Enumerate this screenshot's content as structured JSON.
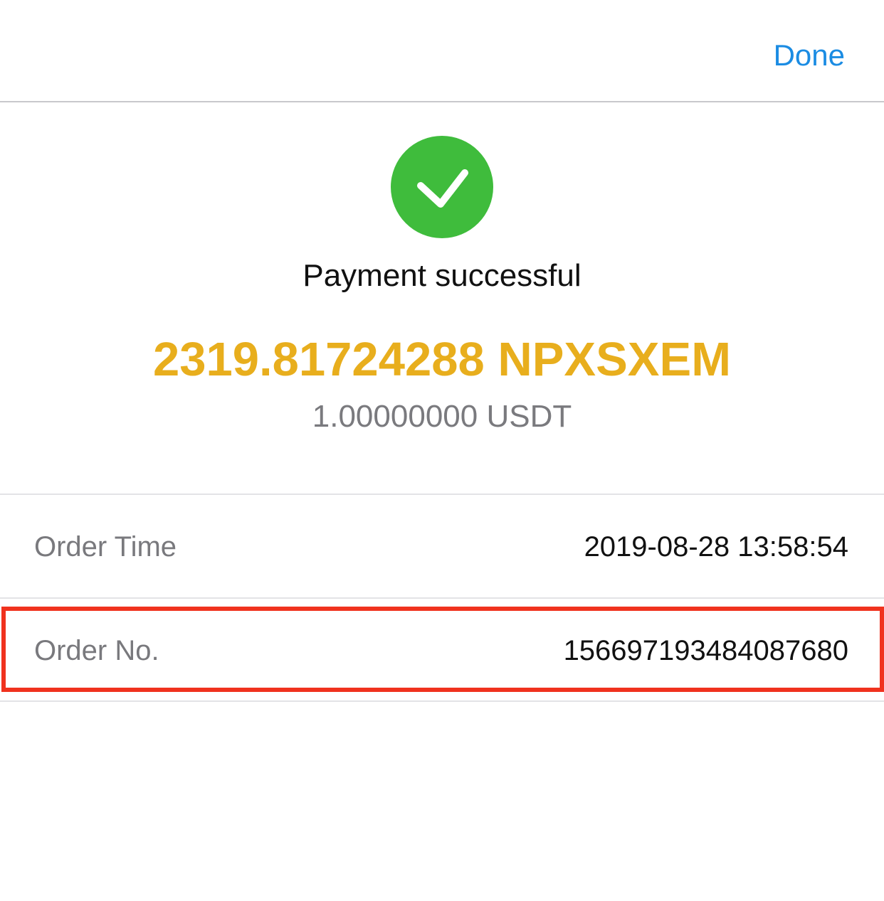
{
  "header": {
    "done_label": "Done"
  },
  "status": {
    "icon": "checkmark-circle-icon",
    "title": "Payment successful"
  },
  "amount": {
    "primary": "2319.81724288 NPXSXEM",
    "secondary": "1.00000000 USDT"
  },
  "details": [
    {
      "label": "Order Time",
      "value": "2019-08-28 13:58:54"
    },
    {
      "label": "Order No.",
      "value": "156697193484087680"
    }
  ],
  "colors": {
    "accent": "#1b8ce3",
    "success": "#3fbc3c",
    "amount": "#e8ae1d",
    "highlight": "#f0321e"
  }
}
